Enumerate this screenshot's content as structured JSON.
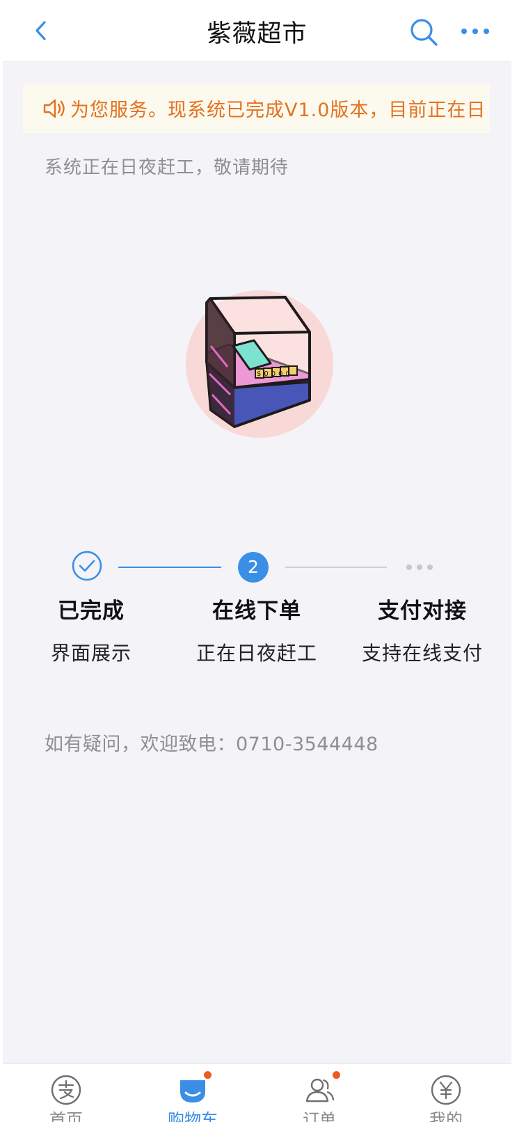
{
  "header": {
    "title": "紫薇超市"
  },
  "notice": {
    "text": "为您服务。现系统已完成V1.0版本，目前正在日"
  },
  "subtitle": "系统正在日夜赶工，敬请期待",
  "illustration": {
    "price_tag": "$0000"
  },
  "steps": [
    {
      "title": "已完成",
      "subtitle": "界面展示",
      "state": "done"
    },
    {
      "title": "在线下单",
      "subtitle": "正在日夜赶工",
      "state": "current",
      "number": "2"
    },
    {
      "title": "支付对接",
      "subtitle": "支持在线支付",
      "state": "pending"
    }
  ],
  "contact": "如有疑问，欢迎致电：0710-3544448",
  "tabbar": {
    "items": [
      {
        "label": "首页",
        "icon": "alipay-icon",
        "active": false,
        "badge": false
      },
      {
        "label": "购物车",
        "icon": "cart-icon",
        "active": true,
        "badge": true
      },
      {
        "label": "订单",
        "icon": "users-icon",
        "active": false,
        "badge": true
      },
      {
        "label": "我的",
        "icon": "yen-icon",
        "active": false,
        "badge": false
      }
    ]
  },
  "colors": {
    "accent": "#3a8ee6",
    "notice_text": "#e4711e",
    "notice_bg": "#fcf9ee",
    "badge": "#f05a22"
  }
}
